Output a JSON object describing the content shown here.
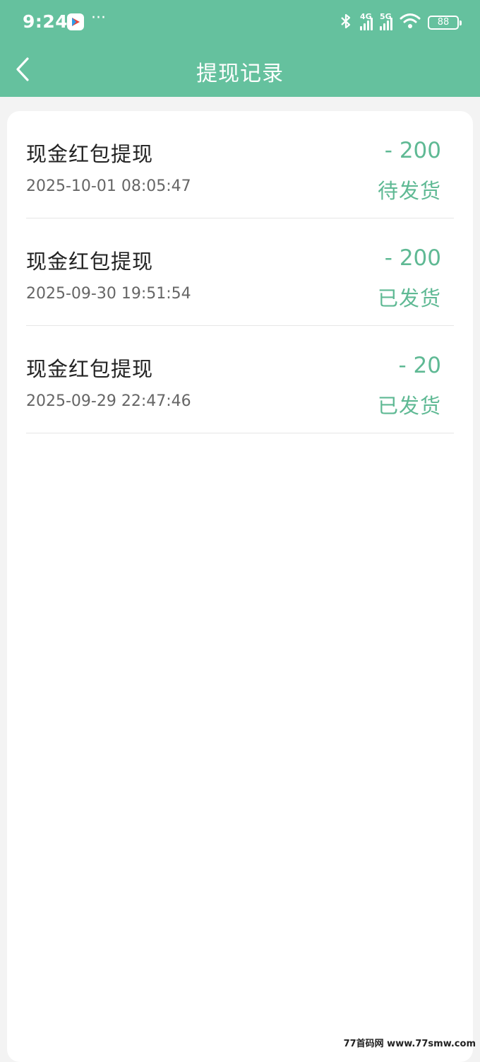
{
  "status_bar": {
    "time": "9:24",
    "more": "···",
    "net_1": "4G",
    "net_2": "5G",
    "battery": "88",
    "icons": [
      "bluetooth-icon",
      "signal-4g-icon",
      "signal-5g-icon",
      "wifi-icon",
      "battery-icon"
    ]
  },
  "nav": {
    "title": "提现记录",
    "back_icon": "chevron-left-icon"
  },
  "records": [
    {
      "title": "现金红包提现",
      "time": "2025-10-01 08:05:47",
      "amount": "- 200",
      "status": "待发货"
    },
    {
      "title": "现金红包提现",
      "time": "2025-09-30 19:51:54",
      "amount": "- 200",
      "status": "已发货"
    },
    {
      "title": "现金红包提现",
      "time": "2025-09-29 22:47:46",
      "amount": "- 20",
      "status": "已发货"
    }
  ],
  "watermark": "77首码网 www.77smw.com",
  "colors": {
    "header": "#65c19e",
    "accent": "#5fb994",
    "background": "#f3f3f3",
    "card": "#ffffff"
  }
}
